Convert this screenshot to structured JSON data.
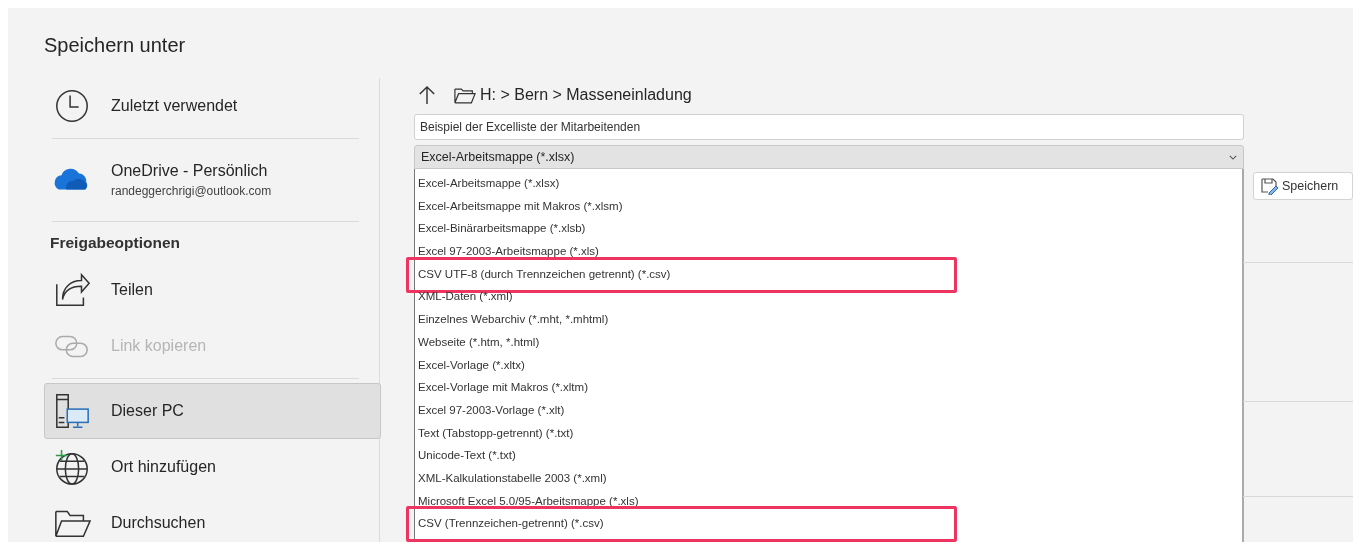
{
  "title": "Speichern unter",
  "sidebar": {
    "sections": [
      {
        "items": [
          {
            "label": "Zuletzt verwendet",
            "disabled": false,
            "selected": false
          }
        ]
      },
      {
        "items": [
          {
            "label": "OneDrive - Persönlich",
            "sub": "randeggerchrigi@outlook.com",
            "disabled": false,
            "selected": false
          }
        ]
      },
      {
        "heading": "Freigabeoptionen",
        "items": [
          {
            "label": "Teilen",
            "disabled": false,
            "selected": false
          },
          {
            "label": "Link kopieren",
            "disabled": true,
            "selected": false
          }
        ]
      },
      {
        "items": [
          {
            "label": "Dieser PC",
            "disabled": false,
            "selected": true
          },
          {
            "label": "Ort hinzufügen",
            "disabled": false,
            "selected": false
          },
          {
            "label": "Durchsuchen",
            "disabled": false,
            "selected": false
          }
        ]
      }
    ]
  },
  "breadcrumb": "H: > Bern > Masseneinladung",
  "filename": {
    "value": "Beispiel der Excelliste der Mitarbeitenden"
  },
  "file_type": {
    "value": "Excel-Arbeitsmappe (*.xlsx)",
    "expanded": true,
    "options": [
      {
        "label": "Excel-Arbeitsmappe (*.xlsx)",
        "highlighted": false
      },
      {
        "label": "Excel-Arbeitsmappe mit Makros (*.xlsm)",
        "highlighted": false
      },
      {
        "label": "Excel-Binärarbeitsmappe (*.xlsb)",
        "highlighted": false
      },
      {
        "label": "Excel 97-2003-Arbeitsmappe (*.xls)",
        "highlighted": false
      },
      {
        "label": "CSV UTF-8 (durch Trennzeichen getrennt) (*.csv)",
        "highlighted": true
      },
      {
        "label": "XML-Daten (*.xml)",
        "highlighted": false
      },
      {
        "label": "Einzelnes Webarchiv (*.mht, *.mhtml)",
        "highlighted": false
      },
      {
        "label": "Webseite (*.htm, *.html)",
        "highlighted": false
      },
      {
        "label": "Excel-Vorlage (*.xltx)",
        "highlighted": false
      },
      {
        "label": "Excel-Vorlage mit Makros (*.xltm)",
        "highlighted": false
      },
      {
        "label": "Excel 97-2003-Vorlage (*.xlt)",
        "highlighted": false
      },
      {
        "label": "Text (Tabstopp-getrennt) (*.txt)",
        "highlighted": false
      },
      {
        "label": "Unicode-Text (*.txt)",
        "highlighted": false
      },
      {
        "label": "XML-Kalkulationstabelle 2003 (*.xml)",
        "highlighted": false
      },
      {
        "label": "Microsoft Excel 5.0/95-Arbeitsmappe (*.xls)",
        "highlighted": false
      },
      {
        "label": "CSV (Trennzeichen-getrennt) (*.csv)",
        "highlighted": true
      }
    ]
  },
  "save_button": "Speichern"
}
